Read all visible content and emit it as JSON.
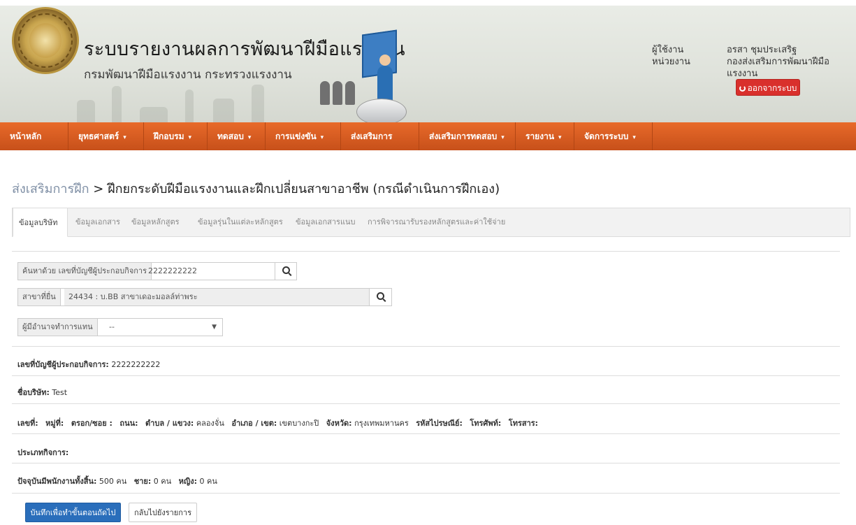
{
  "header": {
    "title": "ระบบรายงานผลการพัฒนาฝีมือแรงงาน",
    "subtitle": "กรมพัฒนาฝีมือแรงงาน กระทรวงแรงงาน",
    "user_label": "ผู้ใช้งาน",
    "unit_label": "หน่วยงาน",
    "user_name": "อรสา ชุมประเสริฐ",
    "unit_name": "กองส่งเสริมการพัฒนาฝีมือแรงงาน",
    "logout_label": "ออกจากระบบ",
    "logout_icon": "power-icon"
  },
  "nav": {
    "items": [
      {
        "label": "หน้าหลัก"
      },
      {
        "label": "ยุทธศาสตร์"
      },
      {
        "label": "ฝึกอบรม"
      },
      {
        "label": "ทดสอบ"
      },
      {
        "label": "การแข่งขัน"
      },
      {
        "label": "ส่งเสริมการฝึก"
      },
      {
        "label": "ส่งเสริมการทดสอบ"
      },
      {
        "label": "รายงาน"
      },
      {
        "label": "จัดการระบบ"
      }
    ]
  },
  "page": {
    "breadcrumb": "ส่งเสริมการฝึก",
    "separator": " > ",
    "title": "ฝึกยกระดับฝีมือแรงงานและฝึกเปลี่ยนสาขาอาชีพ (กรณีดำเนินการฝึกเอง)"
  },
  "tabs": [
    {
      "label": "ข้อมูลบริษัท",
      "active": true
    },
    {
      "label": "ข้อมูลเอกสาร"
    },
    {
      "label": "ข้อมูลหลักสูตร"
    },
    {
      "label": "ข้อมูลรุ่นในแต่ละหลักสูตร"
    },
    {
      "label": "ข้อมูลเอกสารแนบ"
    },
    {
      "label": "การพิจารณารับรองหลักสูตรและค่าใช้จ่าย"
    }
  ],
  "form": {
    "search_label": "ค้นหาด้วย เลขที่บัญชีผู้ประกอบกิจการ",
    "search_value": "2222222222",
    "branch_label": "สาขาที่ยื่น",
    "branch_value": "24434 : บ.BB สาขาเดอะมอลล์ท่าพระ",
    "authority_label": "ผู้มีอำนาจทำการแทน",
    "authority_value": "--"
  },
  "company": {
    "account_label": "เลขที่บัญชีผู้ประกอบกิจการ:",
    "account_value": "2222222222",
    "name_label": "ชื่อบริษัท:",
    "name_value": "Test",
    "address": {
      "no_label": "เลขที่:",
      "moo_label": "หมู่ที่:",
      "soi_label": "ตรอก/ซอย :",
      "road_label": "ถนน:",
      "subdistrict_label": "ตำบล / แขวง:",
      "subdistrict_value": "คลองจั่น",
      "district_label": "อำเภอ / เขต:",
      "district_value": "เขตบางกะปิ",
      "province_label": "จังหวัด:",
      "province_value": "กรุงเทพมหานคร",
      "postcode_label": "รหัสไปรษณีย์:",
      "phone_label": "โทรศัพท์:",
      "fax_label": "โทรสาร:"
    },
    "business_type_label": "ประเภทกิจการ:",
    "employees_label": "ปัจจุบันมีพนักงานทั้งสิ้น:",
    "employees_value": "500 คน",
    "male_label": "ชาย:",
    "male_value": "0 คน",
    "female_label": "หญิง:",
    "female_value": "0 คน"
  },
  "actions": {
    "save_label": "บันทึกเพื่อทำขั้นตอนถัดไป",
    "back_label": "กลับไปยังรายการ"
  }
}
